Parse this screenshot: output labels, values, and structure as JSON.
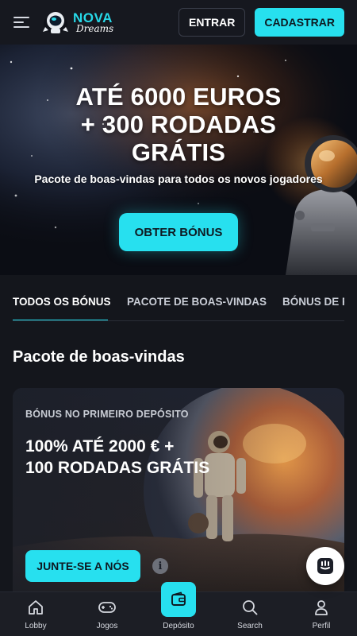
{
  "header": {
    "logo_top": "NOVA",
    "logo_bottom": "Dreams",
    "login_label": "ENTRAR",
    "register_label": "CADASTRAR"
  },
  "hero": {
    "title": "ATÉ 6000 EUROS\n+ 300 RODADAS\nGRÁTIS",
    "subtitle": "Pacote de boas-vindas para todos os novos jogadores",
    "cta_label": "OBTER BÓNUS"
  },
  "tabs": [
    {
      "label": "TODOS OS BÓNUS",
      "active": true
    },
    {
      "label": "PACOTE DE BOAS-VINDAS",
      "active": false
    },
    {
      "label": "BÓNUS DE R",
      "active": false
    }
  ],
  "section": {
    "title": "Pacote de boas-vindas"
  },
  "card": {
    "eyebrow": "BÓNUS NO PRIMEIRO DEPÓSITO",
    "title": "100% ATÉ 2000 € +\n100 RODADAS GRÁTIS",
    "cta_label": "JUNTE-SE A NÓS",
    "info_glyph": "i"
  },
  "bottom_nav": [
    {
      "label": "Lobby",
      "icon": "home-icon"
    },
    {
      "label": "Jogos",
      "icon": "gamepad-icon"
    },
    {
      "label": "Depósito",
      "icon": "wallet-icon"
    },
    {
      "label": "Search",
      "icon": "search-icon"
    },
    {
      "label": "Perfil",
      "icon": "user-icon"
    }
  ],
  "colors": {
    "accent": "#27e0ef",
    "background": "#14161c",
    "header": "#16181f",
    "nav": "#1c1e25"
  }
}
